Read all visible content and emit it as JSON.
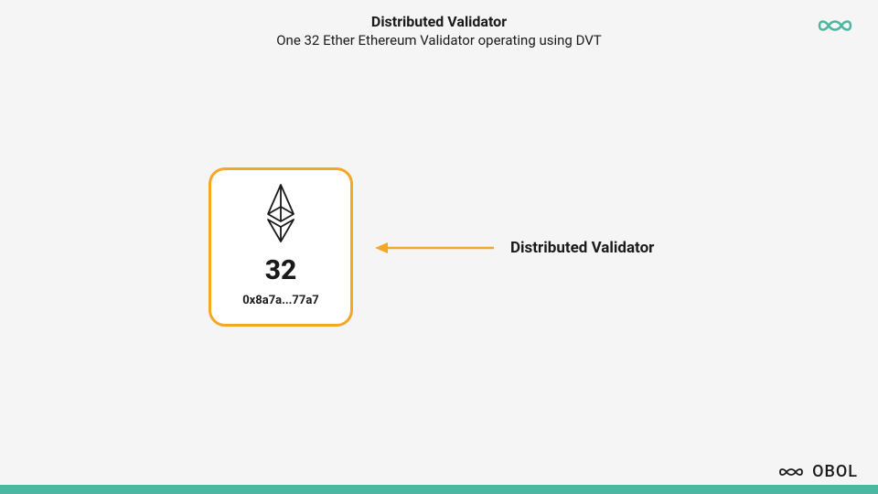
{
  "header": {
    "title": "Distributed Validator",
    "subtitle": "One 32 Ether Ethereum Validator operating using DVT"
  },
  "validator": {
    "amount": "32",
    "address": "0x8a7a...77a7"
  },
  "arrow": {
    "label": "Distributed Validator"
  },
  "brand": {
    "name": "OBOL"
  },
  "colors": {
    "accent": "#f5a623",
    "teal": "#4db6a0"
  }
}
